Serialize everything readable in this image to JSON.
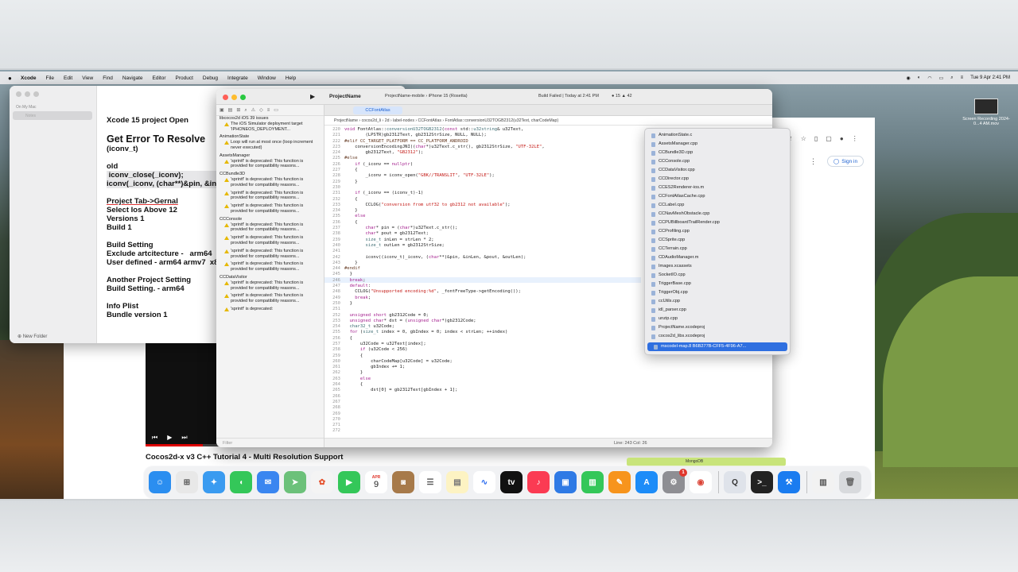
{
  "menubar": {
    "items": [
      "Xcode",
      "File",
      "Edit",
      "View",
      "Find",
      "Navigate",
      "Editor",
      "Product",
      "Debug",
      "Integrate",
      "Window",
      "Help"
    ],
    "clock": "Tue 9 Apr  2:41 PM"
  },
  "desktop_icon": {
    "label": "Screen Recording 2024-0...4 AM.mov"
  },
  "notes": {
    "sidebar_header": "On My Mac",
    "sidebar_selected": "Notes",
    "new_folder": "New Folder",
    "lines": [
      "Xcode 15 project Open",
      "Get Error To Resolve",
      "(iconv_t)",
      "old",
      " iconv_close(_iconv);",
      "iconv(_iconv, (char**)&pin, &inLen",
      "Project Tab->Gernal",
      "Select Ios Above 12",
      "Versions 1",
      "Build 1",
      "Build Setting",
      "Exclude artcitecture -   arm64",
      "User defined - arm64 armv7  x8",
      "Another Project Setting",
      "Build Setting. - arm64",
      "Info Plist",
      "Bundle version 1"
    ]
  },
  "browser": {
    "video_title": "Cocos2d-x v3 C++ Tutorial 4 - Multi Resolution Support",
    "sign_in": "Sign in"
  },
  "xcode": {
    "project_name": "ProjectName",
    "scheme": "ProjectName-mobile  ›  iPhone 15 (Rosetta)",
    "build_status": "Build Failed | Today at 2:41 PM",
    "issue_counts": "● 15  ▲ 42",
    "active_tab": "CCFontAtlas",
    "breadcrumb": "ProjectName  ›  cocos2d_li  ›  2d  ›  label-nodes  ›  CCFontAtlas  ›  FontAtlas::conversionU32TOGB2312(u32Text, charCodeMap)",
    "cursor_position": "Line: 243  Col: 26",
    "filter_placeholder": "Filter",
    "navigator": [
      {
        "type": "grp",
        "text": "libcocos2d iOS  39 issues"
      },
      {
        "type": "warn",
        "text": "The iOS Simulator deployment target 'IPHONEOS_DEPLOYMENT..."
      },
      {
        "type": "grp",
        "text": "AnimationState"
      },
      {
        "type": "warn",
        "text": "Loop will run at most once (loop increment never executed)"
      },
      {
        "type": "grp",
        "text": "AssetsManager"
      },
      {
        "type": "warn",
        "text": "'sprintf' is deprecated: This function is provided for compatibility reasons..."
      },
      {
        "type": "grp",
        "text": "CCBundle3D"
      },
      {
        "type": "warn",
        "text": "'sprintf' is deprecated: This function is provided for compatibility reasons..."
      },
      {
        "type": "warn",
        "text": "'sprintf' is deprecated: This function is provided for compatibility reasons..."
      },
      {
        "type": "warn",
        "text": "'sprintf' is deprecated: This function is provided for compatibility reasons..."
      },
      {
        "type": "grp",
        "text": "CCConsole"
      },
      {
        "type": "warn",
        "text": "'sprintf' is deprecated: This function is provided for compatibility reasons..."
      },
      {
        "type": "warn",
        "text": "'sprintf' is deprecated: This function is provided for compatibility reasons..."
      },
      {
        "type": "warn",
        "text": "'sprintf' is deprecated: This function is provided for compatibility reasons..."
      },
      {
        "type": "warn",
        "text": "'sprintf' is deprecated: This function is provided for compatibility reasons..."
      },
      {
        "type": "grp",
        "text": "CCDataVisitor"
      },
      {
        "type": "warn",
        "text": "'sprintf' is deprecated: This function is provided for compatibility reasons..."
      },
      {
        "type": "warn",
        "text": "'sprintf' is deprecated: This function is provided for compatibility reasons..."
      },
      {
        "type": "warn",
        "text": "'sprintf' is deprecated:"
      }
    ],
    "line_numbers": [
      "220",
      "221",
      "222",
      "223",
      "224",
      "225",
      "226",
      "227",
      "228",
      "229",
      "230",
      "231",
      "232",
      "233",
      "234",
      "235",
      "236",
      "237",
      "238",
      "239",
      "240",
      "241",
      "242",
      "243",
      "244",
      "245",
      "246",
      "247",
      "248",
      "249",
      "250",
      "251",
      "252",
      "253",
      "254",
      "255",
      "256",
      "257",
      "258",
      "259",
      "260",
      "261",
      "262",
      "263",
      "264",
      "265",
      "266",
      "267",
      "268",
      "269",
      "270",
      "271",
      "272"
    ]
  },
  "popup_files": [
    "AnimationState.c",
    "AssetsManager.cpp",
    "CCBundle3D.cpp",
    "CCConsole.cpp",
    "CCDataVisitor.cpp",
    "CCDirector.cpp",
    "CCES2Renderer-ios.m",
    "CCFontAtlasCache.cpp",
    "CCLabel.cpp",
    "CCNavMeshObstacle.cpp",
    "CCPUBillboardTrailRender.cpp",
    "CCProfiling.cpp",
    "CCSprite.cpp",
    "CCTerrain.cpp",
    "CDAudioManager.m",
    "Images.xcassets",
    "SocketIO.cpp",
    "TriggerBase.cpp",
    "TriggerObj.cpp",
    "ccUtils.cpp",
    "idl_parser.cpp",
    "unzip.cpp",
    "ProjectName.xcodeproj",
    "cocos2d_libs.xcodeproj"
  ],
  "popup_selected": "mscodel-map.8 B6B277B-CFF5-4F96-A7...",
  "dock": {
    "mongo_label": "MongoDB",
    "calendar_month": "APR",
    "calendar_day": "9",
    "apps": [
      "finder",
      "launchpad",
      "safari",
      "messages",
      "mail",
      "maps",
      "photos",
      "facetime",
      "calendar",
      "notes-brown",
      "reminders",
      "notes",
      "freeform",
      "tv",
      "music",
      "keynote",
      "numbers",
      "pages",
      "app-store",
      "system-settings",
      "chrome",
      "quicktime",
      "terminal",
      "xcode",
      "files",
      "trash"
    ],
    "settings_badge": "1"
  },
  "colors": {
    "accent": "#2f6fe0",
    "error": "#e0362c",
    "warning": "#e6b800"
  }
}
